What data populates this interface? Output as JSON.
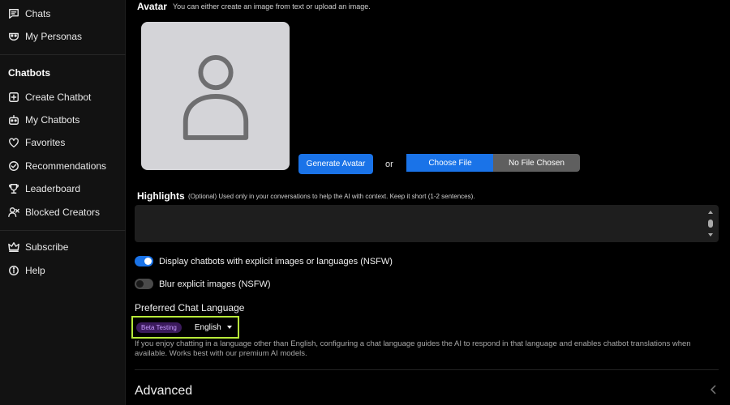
{
  "sidebar": {
    "top_items": [
      {
        "label": "Chats",
        "icon": "chat-icon"
      },
      {
        "label": "My Personas",
        "icon": "mask-icon"
      }
    ],
    "section_title": "Chatbots",
    "items": [
      {
        "label": "Create Chatbot",
        "icon": "plus-square-icon"
      },
      {
        "label": "My Chatbots",
        "icon": "robot-icon"
      },
      {
        "label": "Favorites",
        "icon": "heart-icon"
      },
      {
        "label": "Recommendations",
        "icon": "compass-icon"
      },
      {
        "label": "Leaderboard",
        "icon": "trophy-icon"
      },
      {
        "label": "Blocked Creators",
        "icon": "user-x-icon"
      }
    ],
    "bottom_items": [
      {
        "label": "Subscribe",
        "icon": "crown-icon"
      },
      {
        "label": "Help",
        "icon": "info-icon"
      }
    ]
  },
  "avatar": {
    "label": "Avatar",
    "hint": "You can either create an image from text or upload an image.",
    "generate_button": "Generate Avatar",
    "or_text": "or",
    "choose_file": "Choose File",
    "no_file": "No File Chosen"
  },
  "highlights": {
    "label": "Highlights",
    "hint": "(Optional) Used only in your conversations to help the AI with context. Keep it short (1-2 sentences).",
    "value": ""
  },
  "toggles": {
    "nsfw_display": {
      "label": "Display chatbots with explicit images or languages (NSFW)",
      "on": true
    },
    "nsfw_blur": {
      "label": "Blur explicit images (NSFW)",
      "on": false
    }
  },
  "language": {
    "title": "Preferred Chat Language",
    "badge": "Beta Testing",
    "selected": "English",
    "description": "If you enjoy chatting in a language other than English, configuring a chat language guides the AI to respond in that language and enables chatbot translations when available. Works best with our premium AI models."
  },
  "advanced": {
    "title": "Advanced"
  },
  "colors": {
    "accent": "#1a73e8",
    "highlight_border": "#b7ea3a",
    "badge_bg": "#3b1a5c",
    "badge_text": "#c79bff"
  }
}
